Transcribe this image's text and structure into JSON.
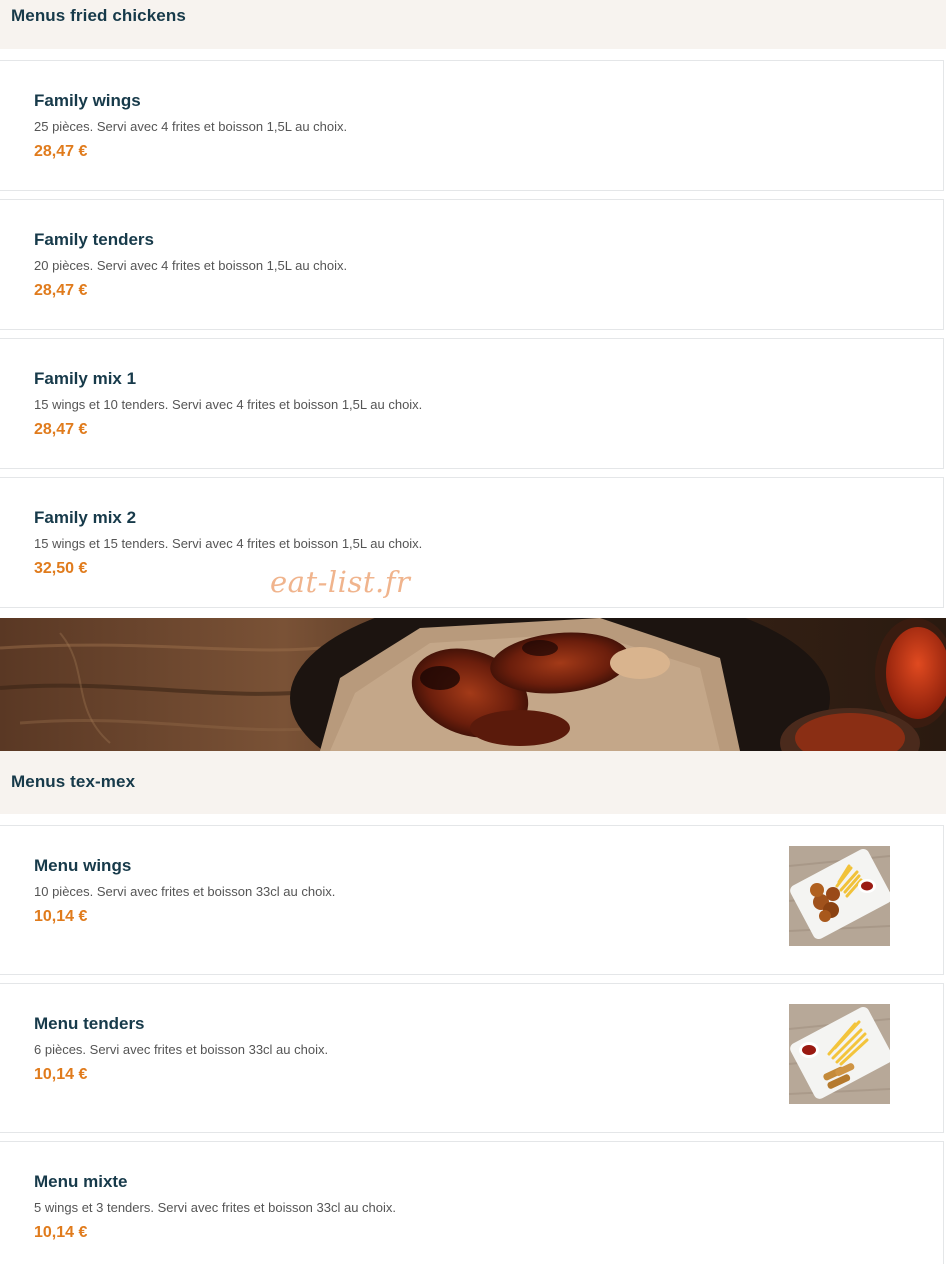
{
  "sections": [
    {
      "title": "Menus fried chickens",
      "items": [
        {
          "name": "Family wings",
          "description": "25 pièces. Servi avec 4 frites et boisson 1,5L au choix.",
          "price": "28,47 €"
        },
        {
          "name": "Family tenders",
          "description": "20 pièces. Servi avec 4 frites et boisson 1,5L au choix.",
          "price": "28,47 €"
        },
        {
          "name": "Family mix 1",
          "description": "15 wings et 10 tenders. Servi avec 4 frites et boisson 1,5L au choix.",
          "price": "28,47 €"
        },
        {
          "name": "Family mix 2",
          "description": "15 wings et 15 tenders. Servi avec 4 frites et boisson 1,5L au choix.",
          "price": "32,50 €"
        }
      ]
    },
    {
      "title": "Menus tex-mex",
      "items": [
        {
          "name": "Menu wings",
          "description": "10 pièces. Servi avec frites et boisson 33cl au choix.",
          "price": "10,14 €",
          "image": "wings-with-fries-photo"
        },
        {
          "name": "Menu tenders",
          "description": "6 pièces. Servi avec frites et boisson 33cl au choix.",
          "price": "10,14 €",
          "image": "tenders-with-fries-photo"
        },
        {
          "name": "Menu mixte",
          "description": "5 wings et 3 tenders. Servi avec frites et boisson 33cl au choix.",
          "price": "10,14 €"
        }
      ]
    }
  ],
  "watermark": "eat-list.fr",
  "banner": {
    "image": "grilled-chicken-banner-photo"
  },
  "colors": {
    "title": "#173a4a",
    "price": "#e07b1c",
    "section_bg": "#f7f3ef",
    "watermark": "#f0b48d"
  }
}
